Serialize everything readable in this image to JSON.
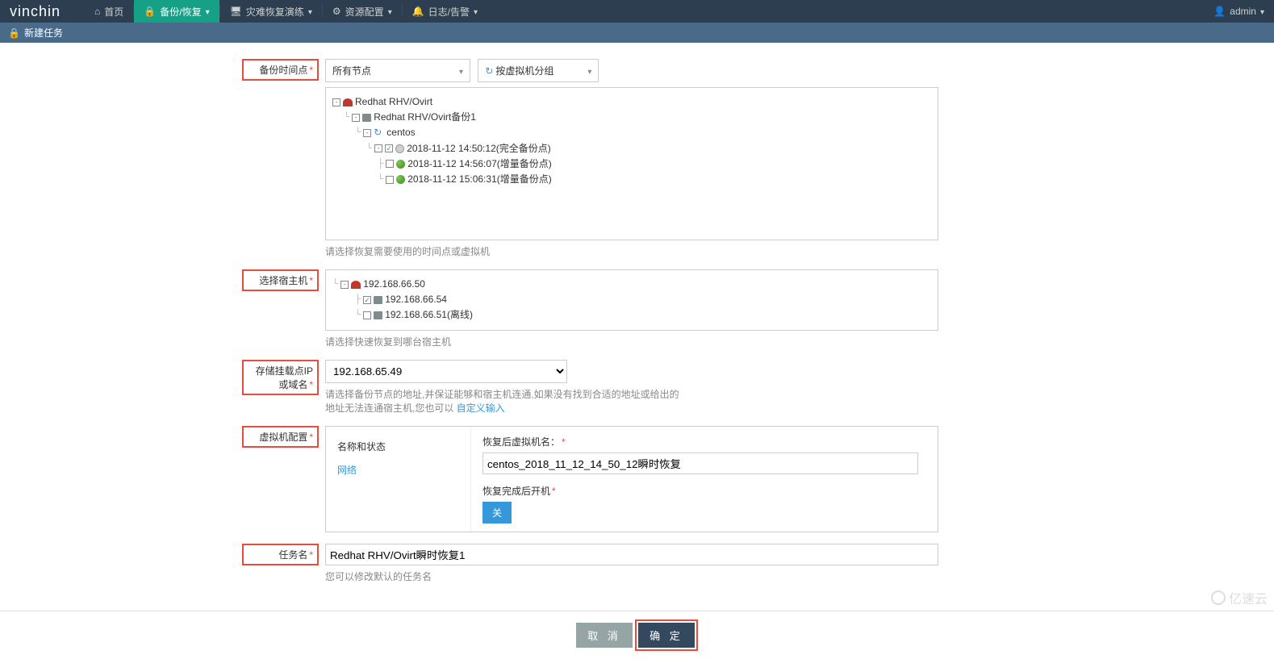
{
  "header": {
    "brand": "vinchin",
    "nav": [
      {
        "icon": "home",
        "label": "首页"
      },
      {
        "icon": "lock",
        "label": "备份/恢复"
      },
      {
        "icon": "desktop",
        "label": "灾难恢复演练"
      },
      {
        "icon": "cog",
        "label": "资源配置"
      },
      {
        "icon": "bell",
        "label": "日志/告警"
      }
    ],
    "user": "admin"
  },
  "subheader": {
    "icon": "lock",
    "title": "新建任务"
  },
  "form": {
    "backupTime": {
      "label": "备份时间点",
      "nodeSelect": "所有节点",
      "groupSelect": "按虚拟机分组",
      "tree": {
        "root": "Redhat RHV/Ovirt",
        "job": "Redhat RHV/Ovirt备份1",
        "vm": "centos",
        "points": [
          {
            "label": "2018-11-12 14:50:12(完全备份点)",
            "checked": true
          },
          {
            "label": "2018-11-12 14:56:07(增量备份点)",
            "checked": false
          },
          {
            "label": "2018-11-12 15:06:31(增量备份点)",
            "checked": false
          }
        ]
      },
      "help": "请选择恢复需要使用的时间点或虚拟机"
    },
    "host": {
      "label": "选择宿主机",
      "tree": {
        "root": "192.168.66.50",
        "children": [
          {
            "label": "192.168.66.54",
            "checked": true
          },
          {
            "label": "192.168.66.51(离线)",
            "checked": false
          }
        ]
      },
      "help": "请选择快速恢复到哪台宿主机"
    },
    "storage": {
      "label": "存储挂载点IP或域名",
      "value": "192.168.65.49",
      "helpPrefix": "请选择备份节点的地址,并保证能够和宿主机连通,如果没有找到合适的地址或给出的地址无法连通宿主机,您也可以 ",
      "helpLink": "自定义输入"
    },
    "vmConfig": {
      "label": "虚拟机配置",
      "tabs": [
        "名称和状态",
        "网络"
      ],
      "nameLabel": "恢复后虚拟机名：",
      "nameValue": "centos_2018_11_12_14_50_12瞬时恢复",
      "powerLabel": "恢复完成后开机",
      "powerValue": "关"
    },
    "taskName": {
      "label": "任务名",
      "value": "Redhat RHV/Ovirt瞬时恢复1",
      "help": "您可以修改默认的任务名"
    }
  },
  "buttons": {
    "cancel": "取 消",
    "ok": "确 定"
  },
  "watermark": "亿速云"
}
